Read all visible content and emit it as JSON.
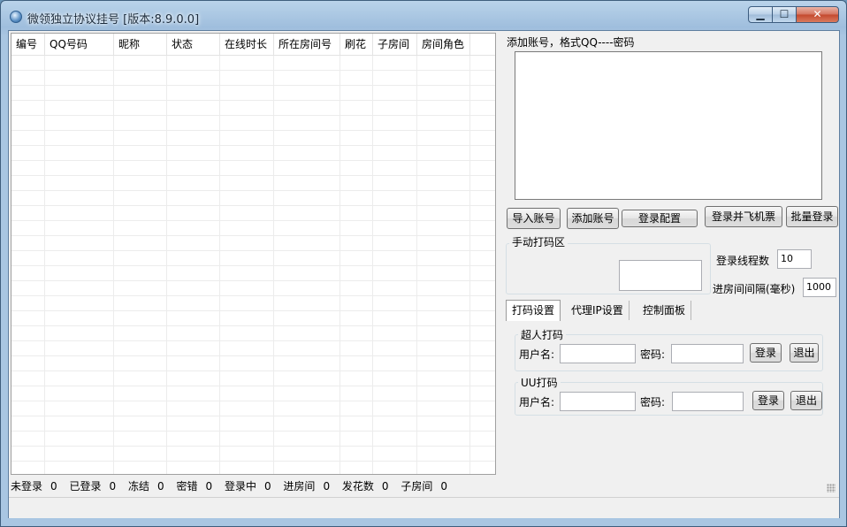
{
  "window": {
    "title": "微领独立协议挂号 [版本:8.9.0.0]",
    "controls": {
      "minimize": "▁",
      "maximize": "☐",
      "close": "✕"
    }
  },
  "grid": {
    "columns": [
      "编号",
      "QQ号码",
      "昵称",
      "状态",
      "在线时长",
      "所在房间号",
      "刷花",
      "子房间",
      "房间角色"
    ],
    "rows": []
  },
  "account_input": {
    "label": "添加账号，格式QQ----密码",
    "value": ""
  },
  "buttons": {
    "import": "导入账号",
    "add": "添加账号",
    "login_config": "登录配置",
    "login_ticket": "登录并飞机票",
    "batch_login": "批量登录"
  },
  "manual_captcha": {
    "title": "手动打码区"
  },
  "settings": {
    "thread_label": "登录线程数",
    "thread_value": "10",
    "interval_label": "进房间间隔(毫秒)",
    "interval_value": "1000"
  },
  "tabs": [
    "打码设置",
    "代理IP设置",
    "控制面板"
  ],
  "captcha_groups": [
    {
      "title": "超人打码",
      "user_label": "用户名:",
      "pass_label": "密码:",
      "login": "登录",
      "logout": "退出"
    },
    {
      "title": "UU打码",
      "user_label": "用户名:",
      "pass_label": "密码:",
      "login": "登录",
      "logout": "退出"
    }
  ],
  "status": [
    {
      "label": "未登录",
      "value": "0"
    },
    {
      "label": "已登录",
      "value": "0"
    },
    {
      "label": "冻结",
      "value": "0"
    },
    {
      "label": "密错",
      "value": "0"
    },
    {
      "label": "登录中",
      "value": "0"
    },
    {
      "label": "进房间",
      "value": "0"
    },
    {
      "label": "发花数",
      "value": "0"
    },
    {
      "label": "子房间",
      "value": "0"
    }
  ]
}
